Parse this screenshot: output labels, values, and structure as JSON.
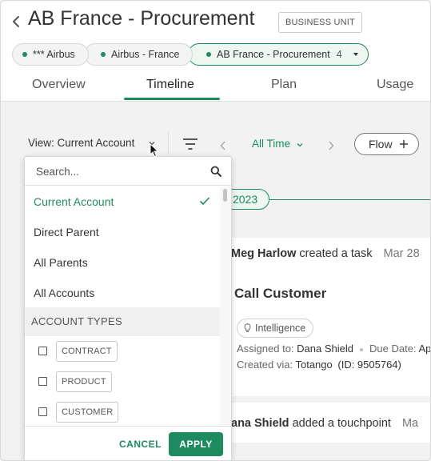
{
  "header": {
    "title": "AB France - Procurement",
    "badge": "BUSINESS UNIT",
    "breadcrumbs": [
      {
        "label": "*** Airbus"
      },
      {
        "label": "Airbus - France"
      },
      {
        "label": "AB France - Procurement",
        "count": "4"
      }
    ]
  },
  "tabs": [
    {
      "label": "Overview"
    },
    {
      "label": "Timeline",
      "active": true
    },
    {
      "label": "Plan"
    },
    {
      "label": "Usage"
    }
  ],
  "toolbar": {
    "view_label": "View: Current Account",
    "time_label": "All Time",
    "flow_label": "Flow"
  },
  "dropdown": {
    "search_placeholder": "Search...",
    "options": [
      {
        "label": "Current Account",
        "selected": true
      },
      {
        "label": "Direct Parent"
      },
      {
        "label": "All Parents"
      },
      {
        "label": "All Accounts"
      }
    ],
    "section_header": "ACCOUNT TYPES",
    "types": [
      {
        "label": "CONTRACT"
      },
      {
        "label": "PRODUCT"
      },
      {
        "label": "CUSTOMER"
      }
    ],
    "cancel_label": "CANCEL",
    "apply_label": "APPLY"
  },
  "timeline": {
    "year": "2023",
    "activity_1": {
      "actor": "Meg Harlow",
      "action": "created a task",
      "date": "Mar 28",
      "title": "Call Customer",
      "tag": "Intelligence",
      "assigned_label": "Assigned to:",
      "assigned_value": "Dana Shield",
      "due_label": "Due Date:",
      "due_value": "Ap",
      "created_label": "Created via:",
      "created_value": "Totango",
      "created_id": "(ID: 9505764)"
    },
    "activity_2": {
      "actor": "ana Shield",
      "action": "added a touchpoint",
      "date": "Ma"
    }
  },
  "colors": {
    "accent": "#1e8a5f",
    "background": "#f2f2f2"
  }
}
